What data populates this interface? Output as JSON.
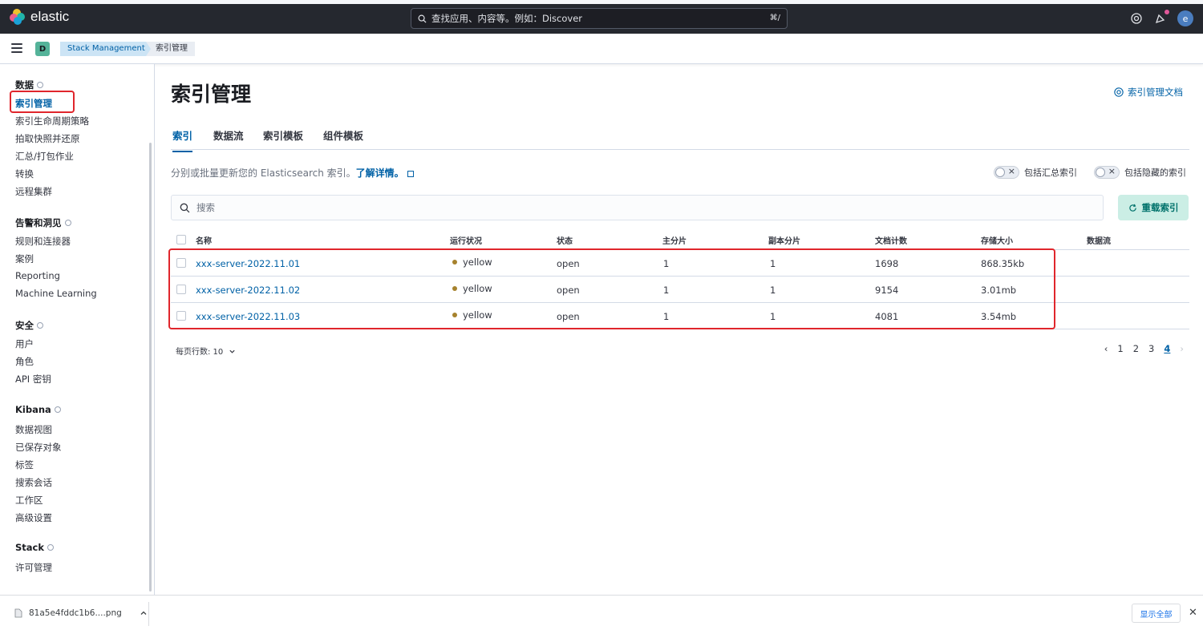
{
  "header": {
    "logo_text": "elastic",
    "search_placeholder": "查找应用、内容等。例如：Discover",
    "search_shortcut": "⌘/",
    "avatar_letter": "e"
  },
  "subheader": {
    "space_letter": "D",
    "breadcrumbs": [
      "Stack Management",
      "索引管理"
    ]
  },
  "sidebar": {
    "groups": [
      {
        "title": "数据",
        "items": [
          "索引管理",
          "索引生命周期策略",
          "拍取快照并还原",
          "汇总/打包作业",
          "转换",
          "远程集群"
        ]
      },
      {
        "title": "告警和洞见",
        "items": [
          "规则和连接器",
          "案例",
          "Reporting",
          "Machine Learning"
        ]
      },
      {
        "title": "安全",
        "items": [
          "用户",
          "角色",
          "API 密钥"
        ]
      },
      {
        "title": "Kibana",
        "items": [
          "数据视图",
          "已保存对象",
          "标签",
          "搜索会话",
          "工作区",
          "高级设置"
        ]
      },
      {
        "title": "Stack",
        "items": [
          "许可管理"
        ]
      }
    ],
    "active_item": "索引管理"
  },
  "main": {
    "title": "索引管理",
    "doc_link": "索引管理文档",
    "tabs": [
      "索引",
      "数据流",
      "索引模板",
      "组件模板"
    ],
    "description": "分别或批量更新您的 Elasticsearch 索引。",
    "learn_more": "了解详情。",
    "toggle_rollup": "包括汇总索引",
    "toggle_hidden": "包括隐藏的索引",
    "search_placeholder": "搜索",
    "reload_button": "重载索引",
    "table": {
      "columns": [
        "名称",
        "运行状况",
        "状态",
        "主分片",
        "副本分片",
        "文档计数",
        "存储大小",
        "数据流"
      ],
      "rows": [
        {
          "name": "xxx-server-2022.11.01",
          "health": "yellow",
          "status": "open",
          "primary": "1",
          "replicas": "1",
          "docs": "1698",
          "size": "868.35kb",
          "data_stream": ""
        },
        {
          "name": "xxx-server-2022.11.02",
          "health": "yellow",
          "status": "open",
          "primary": "1",
          "replicas": "1",
          "docs": "9154",
          "size": "3.01mb",
          "data_stream": ""
        },
        {
          "name": "xxx-server-2022.11.03",
          "health": "yellow",
          "status": "open",
          "primary": "1",
          "replicas": "1",
          "docs": "4081",
          "size": "3.54mb",
          "data_stream": ""
        }
      ]
    },
    "rows_per_page": "每页行数: 10",
    "pagination": {
      "pages": [
        "1",
        "2",
        "3",
        "4"
      ],
      "current": "4"
    }
  },
  "download_bar": {
    "file_name": "81a5e4fddc1b6....png",
    "show_all": "显示全部"
  },
  "colors": {
    "accent": "#0061a6",
    "health_yellow": "#a6822d",
    "highlight_red": "#e0262c",
    "header_bg": "#25282f"
  }
}
